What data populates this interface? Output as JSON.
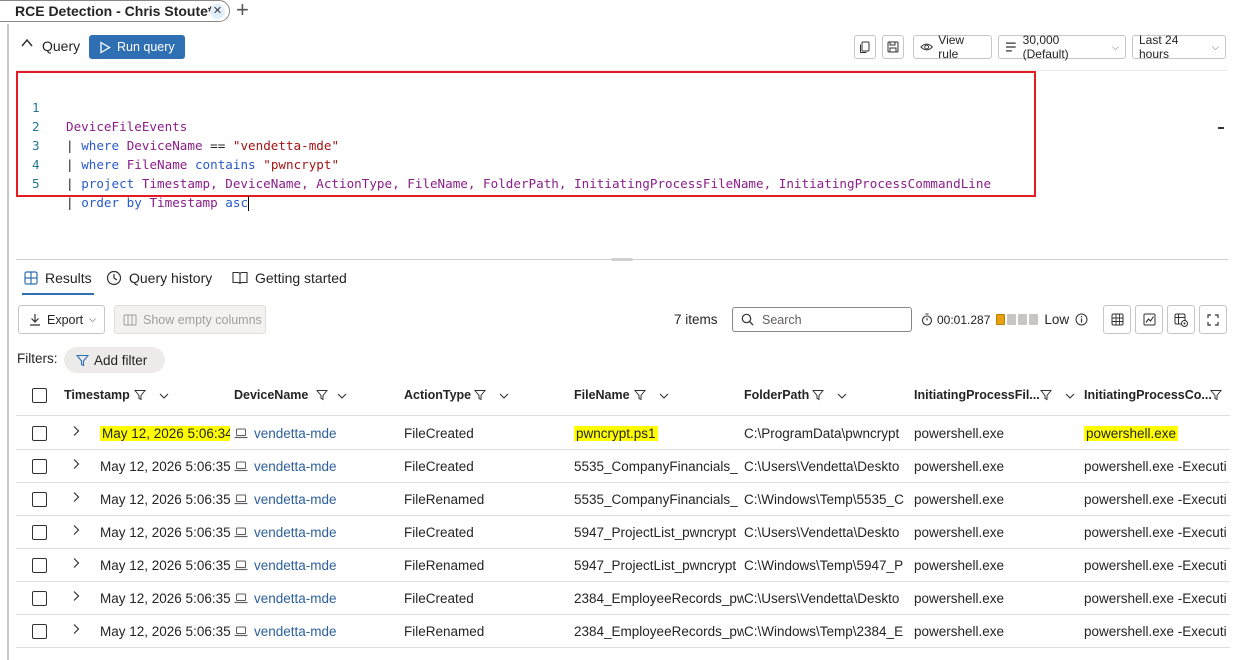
{
  "tab": {
    "title": "RCE Detection - Chris Stoute*",
    "close": "✕",
    "add": "+"
  },
  "query_bar": {
    "label": "Query",
    "run_label": "Run query",
    "view_rule": "View rule",
    "limit": "30,000 (Default)",
    "time_range": "Last 24 hours"
  },
  "editor": {
    "lines": [
      {
        "n": "1"
      },
      {
        "n": "2"
      },
      {
        "n": "3"
      },
      {
        "n": "4"
      },
      {
        "n": "5"
      }
    ],
    "tokens": {
      "l1_table": "DeviceFileEvents",
      "pipe": "|",
      "l2_kw": "where",
      "l2_field": "DeviceName",
      "l2_op": "==",
      "l2_val": "\"vendetta-mde\"",
      "l3_kw": "where",
      "l3_field": "FileName",
      "l3_op": "contains",
      "l3_val": "\"pwncrypt\"",
      "l4_kw": "project",
      "l4_cols": "Timestamp, DeviceName, ActionType, FileName, FolderPath, InitiatingProcessFileName, InitiatingProcessCommandLine",
      "l5_kw": "order by",
      "l5_field": "Timestamp",
      "l5_dir": "asc"
    }
  },
  "results_tabs": [
    "Results",
    "Query history",
    "Getting started"
  ],
  "results_toolbar": {
    "export": "Export",
    "show_empty": "Show empty columns",
    "items": "7 items",
    "search_placeholder": "Search",
    "elapsed": "00:01.287",
    "perf": "Low",
    "perf_segments": [
      "#e8a00d",
      "#c8c6c4",
      "#c8c6c4",
      "#c8c6c4"
    ]
  },
  "filters": {
    "label": "Filters:",
    "add": "Add filter"
  },
  "table": {
    "columns": [
      "Timestamp",
      "DeviceName",
      "ActionType",
      "FileName",
      "FolderPath",
      "InitiatingProcessFil...",
      "InitiatingProcessCo..."
    ],
    "rows": [
      [
        "May 12, 2026 5:06:34",
        "vendetta-mde",
        "FileCreated",
        "pwncrypt.ps1",
        "C:\\ProgramData\\pwncrypt",
        "powershell.exe",
        "powershell.exe"
      ],
      [
        "May 12, 2026 5:06:35",
        "vendetta-mde",
        "FileCreated",
        "5535_CompanyFinancials_",
        "C:\\Users\\Vendetta\\Deskto",
        "powershell.exe",
        "powershell.exe -Executi"
      ],
      [
        "May 12, 2026 5:06:35",
        "vendetta-mde",
        "FileRenamed",
        "5535_CompanyFinancials_",
        "C:\\Windows\\Temp\\5535_C",
        "powershell.exe",
        "powershell.exe -Executi"
      ],
      [
        "May 12, 2026 5:06:35",
        "vendetta-mde",
        "FileCreated",
        "5947_ProjectList_pwncrypt",
        "C:\\Users\\Vendetta\\Deskto",
        "powershell.exe",
        "powershell.exe -Executi"
      ],
      [
        "May 12, 2026 5:06:35",
        "vendetta-mde",
        "FileRenamed",
        "5947_ProjectList_pwncrypt",
        "C:\\Windows\\Temp\\5947_P",
        "powershell.exe",
        "powershell.exe -Executi"
      ],
      [
        "May 12, 2026 5:06:35",
        "vendetta-mde",
        "FileCreated",
        "2384_EmployeeRecords_pw",
        "C:\\Users\\Vendetta\\Deskto",
        "powershell.exe",
        "powershell.exe -Executi"
      ],
      [
        "May 12, 2026 5:06:35",
        "vendetta-mde",
        "FileRenamed",
        "2384_EmployeeRecords_pw",
        "C:\\Windows\\Temp\\2384_E",
        "powershell.exe",
        "powershell.exe -Executi"
      ]
    ]
  },
  "colors": {
    "accent": "#2f6fb3",
    "highlight_border": "#e31c23",
    "highlight_fill": "#ffff00"
  }
}
